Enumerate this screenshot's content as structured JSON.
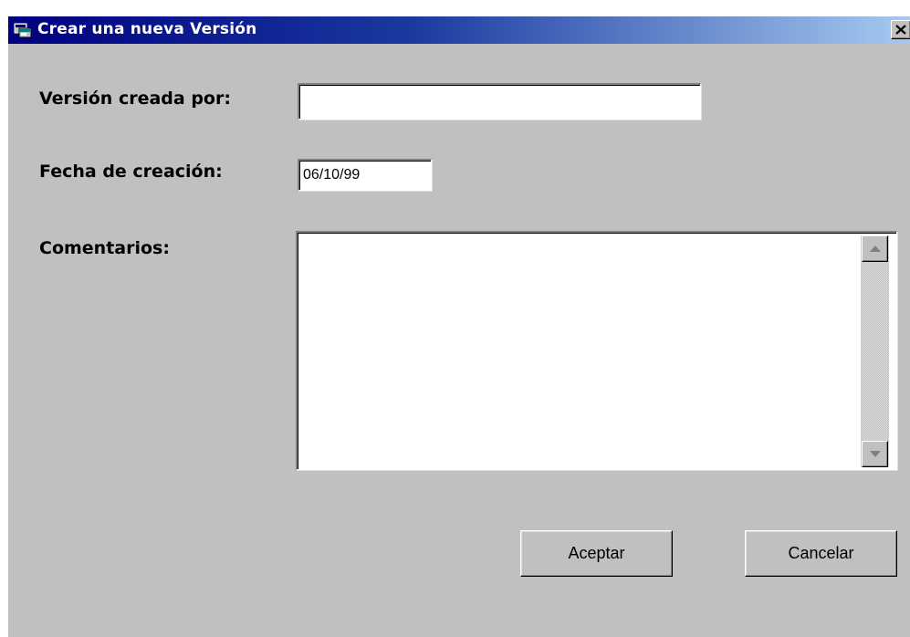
{
  "window": {
    "title": "Crear una nueva Versión",
    "close_glyph": "✕"
  },
  "form": {
    "created_by_label": "Versión creada por:",
    "created_by_value": "",
    "creation_date_label": "Fecha de creación:",
    "creation_date_value": "06/10/99",
    "comments_label": "Comentarios:",
    "comments_value": ""
  },
  "buttons": {
    "accept_label": "Aceptar",
    "cancel_label": "Cancelar"
  },
  "icons": {
    "app": "app-window-icon",
    "close": "close-icon",
    "scroll_up": "scroll-up-arrow-icon",
    "scroll_down": "scroll-down-arrow-icon"
  },
  "colors": {
    "titlebar_start": "#000080",
    "titlebar_end": "#a6caf0",
    "dialog_face": "#c0c0c0",
    "field_background": "#ffffff"
  }
}
